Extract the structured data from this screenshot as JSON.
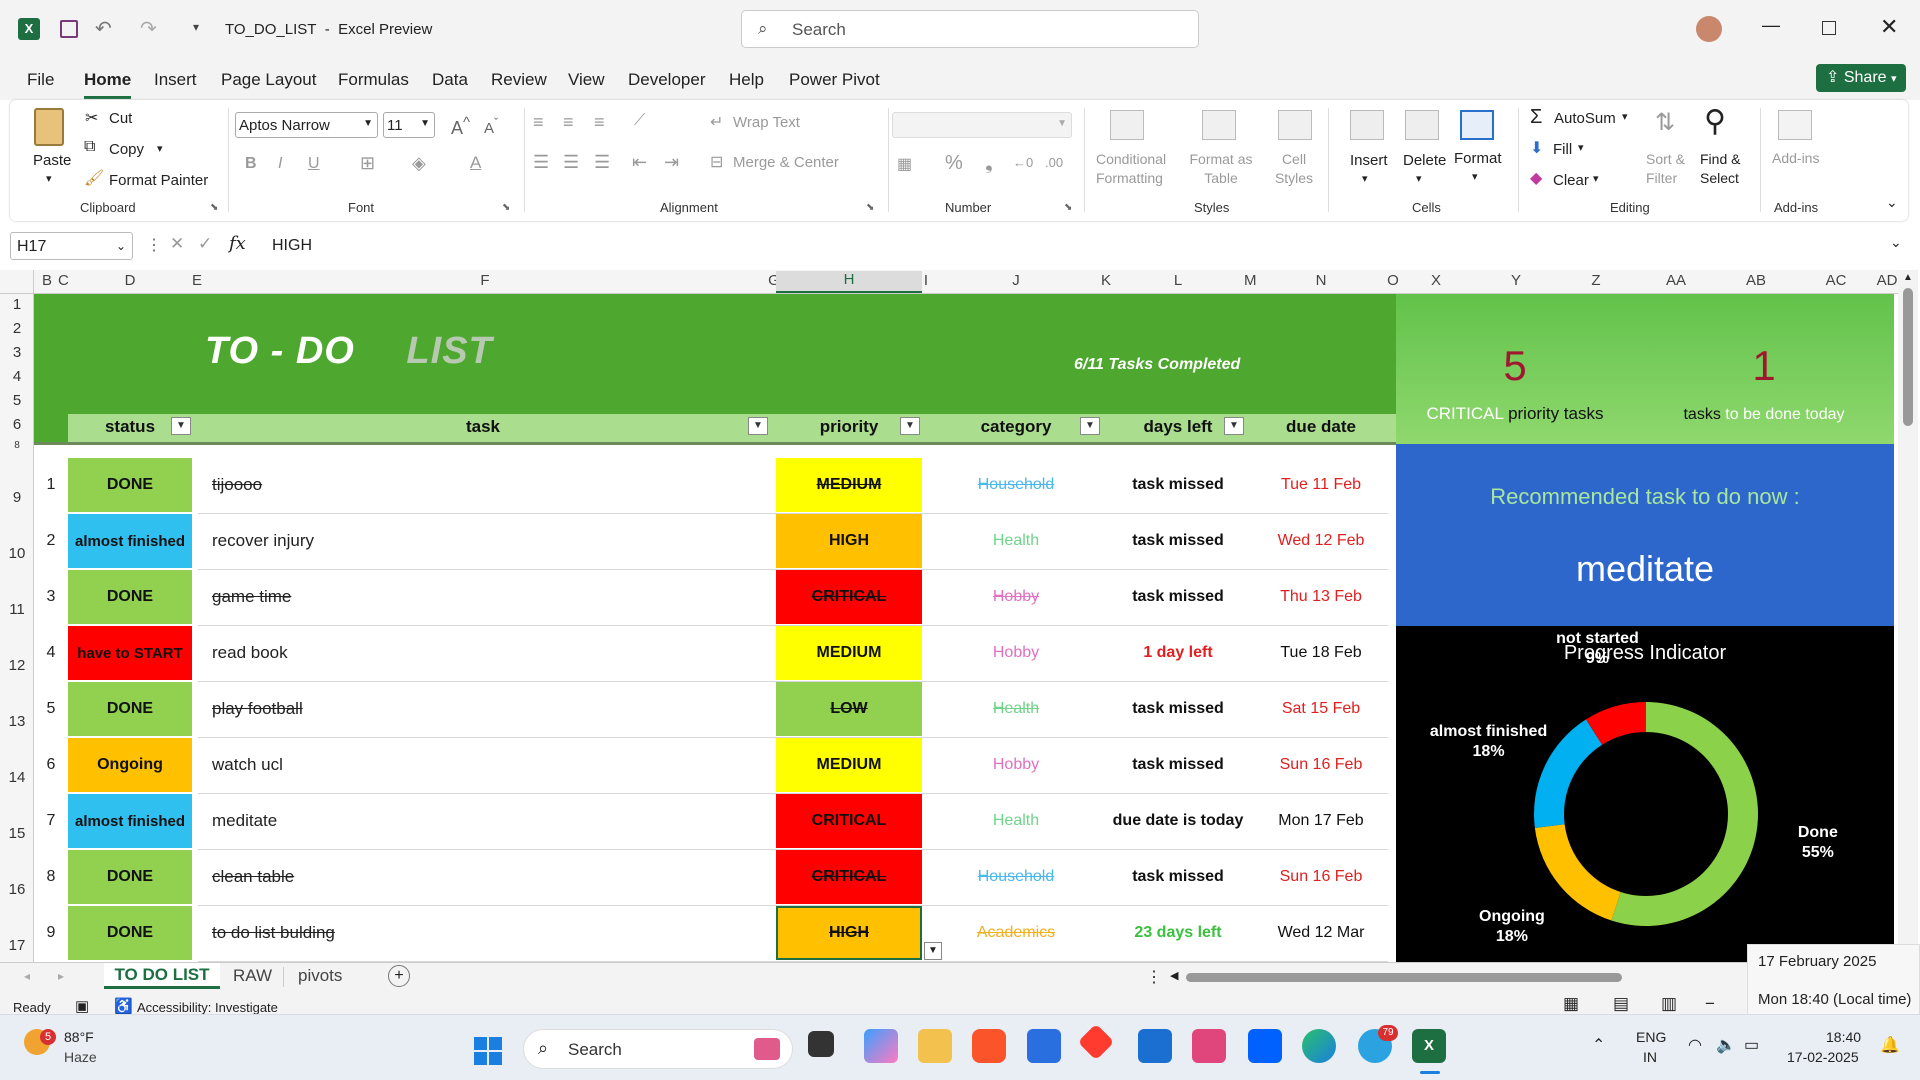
{
  "window": {
    "file_name": "TO_DO_LIST",
    "app_name": "Excel Preview",
    "search_placeholder": "Search"
  },
  "menu": {
    "tabs": [
      "File",
      "Home",
      "Insert",
      "Page Layout",
      "Formulas",
      "Data",
      "Review",
      "View",
      "Developer",
      "Help",
      "Power Pivot"
    ],
    "share_label": "Share"
  },
  "ribbon": {
    "paste": "Paste",
    "cut": "Cut",
    "copy": "Copy",
    "format_painter": "Format Painter",
    "clipboard": "Clipboard",
    "font_name": "Aptos Narrow",
    "font_size": "11",
    "font": "Font",
    "wrap_text": "Wrap Text",
    "merge_center": "Merge & Center",
    "alignment": "Alignment",
    "number": "Number",
    "conditional_formatting": [
      "Conditional",
      "Formatting"
    ],
    "format_as_table": [
      "Format as",
      "Table"
    ],
    "cell_styles": [
      "Cell",
      "Styles"
    ],
    "styles": "Styles",
    "insert": "Insert",
    "delete": "Delete",
    "format": "Format",
    "cells": "Cells",
    "autosum": "AutoSum",
    "fill": "Fill",
    "clear": "Clear",
    "sort_filter": [
      "Sort &",
      "Filter"
    ],
    "find_select": [
      "Find &",
      "Select"
    ],
    "editing": "Editing",
    "addins": "Add-ins",
    "addins_group": "Add-ins"
  },
  "formula_bar": {
    "name_box": "H17",
    "fx": "fx",
    "value": "HIGH"
  },
  "columns": [
    "B",
    "C",
    "D",
    "E",
    "F",
    "G",
    "H",
    "I",
    "J",
    "K",
    "L",
    "M",
    "N",
    "O",
    "X",
    "Y",
    "Z",
    "AA",
    "AB",
    "AC",
    "AD"
  ],
  "rows": [
    "1",
    "2",
    "3",
    "4",
    "5",
    "6",
    "8",
    "9",
    "10",
    "11",
    "12",
    "13",
    "14",
    "15",
    "16",
    "17"
  ],
  "banner": {
    "title": "TO - DO",
    "title2": "LIST",
    "completed": "6/11  Tasks Completed"
  },
  "table_headers": {
    "status": "status",
    "task": "task",
    "priority": "priority",
    "category": "category",
    "days_left": "days left",
    "due_date": "due date"
  },
  "tasks": [
    {
      "num": "1",
      "status": "DONE",
      "task": "tijoooo",
      "priority": "MEDIUM",
      "category": "Household",
      "days_left": "task missed",
      "due": "Tue 11 Feb"
    },
    {
      "num": "2",
      "status": "almost finished",
      "task": "recover injury",
      "priority": "HIGH",
      "category": "Health",
      "days_left": "task missed",
      "due": "Wed 12 Feb"
    },
    {
      "num": "3",
      "status": "DONE",
      "task": "game time",
      "priority": "CRITICAL",
      "category": "Hobby",
      "days_left": "task missed",
      "due": "Thu 13 Feb"
    },
    {
      "num": "4",
      "status": "have to START",
      "task": "read book",
      "priority": "MEDIUM",
      "category": "Hobby",
      "days_left": "1 day left",
      "due": "Tue 18 Feb"
    },
    {
      "num": "5",
      "status": "DONE",
      "task": "play football",
      "priority": "LOW",
      "category": "Health",
      "days_left": "task missed",
      "due": "Sat 15 Feb"
    },
    {
      "num": "6",
      "status": "Ongoing",
      "task": "watch ucl",
      "priority": "MEDIUM",
      "category": "Hobby",
      "days_left": "task missed",
      "due": "Sun 16 Feb"
    },
    {
      "num": "7",
      "status": "almost finished",
      "task": "meditate",
      "priority": "CRITICAL",
      "category": "Health",
      "days_left": "due date is today",
      "due": "Mon 17 Feb"
    },
    {
      "num": "8",
      "status": "DONE",
      "task": "clean table",
      "priority": "CRITICAL",
      "category": "Household",
      "days_left": "task missed",
      "due": "Sun 16 Feb"
    },
    {
      "num": "9",
      "status": "DONE",
      "task": "to do list bulding",
      "priority": "HIGH",
      "category": "Academics",
      "days_left": "23 days left",
      "due": "Wed 12 Mar"
    }
  ],
  "stats": {
    "critical_count": "5",
    "critical_word": "CRITICAL",
    "critical_suffix": "priority tasks",
    "today_count": "1",
    "today_word": "tasks",
    "today_suffix": "to be done today"
  },
  "recommend": {
    "label": "Recommended task to do now :",
    "task": "meditate"
  },
  "chart_data": {
    "type": "pie",
    "title": "Progress Indicator",
    "categories": [
      "Done",
      "Ongoing",
      "almost finished",
      "not started"
    ],
    "values": [
      55,
      18,
      18,
      9
    ],
    "labels": [
      "55%",
      "18%",
      "18%",
      "9%"
    ],
    "colors": [
      "#8cd14a",
      "#ffc000",
      "#00b0f0",
      "#ff0000"
    ]
  },
  "sheets": {
    "tabs": [
      "TO DO LIST",
      "RAW",
      "pivots"
    ],
    "active": "TO DO LIST"
  },
  "status_bar": {
    "ready": "Ready",
    "accessibility": "Accessibility: Investigate"
  },
  "tooltip": {
    "date": "17 February 2025",
    "time": "Mon 18:40 (Local time)"
  },
  "taskbar": {
    "temp": "88°F",
    "weather": "Haze",
    "search": "Search",
    "lang1": "ENG",
    "lang2": "IN",
    "clock_time": "18:40",
    "clock_date": "17-02-2025",
    "weather_badge": "5",
    "telegram_badge": "79"
  }
}
